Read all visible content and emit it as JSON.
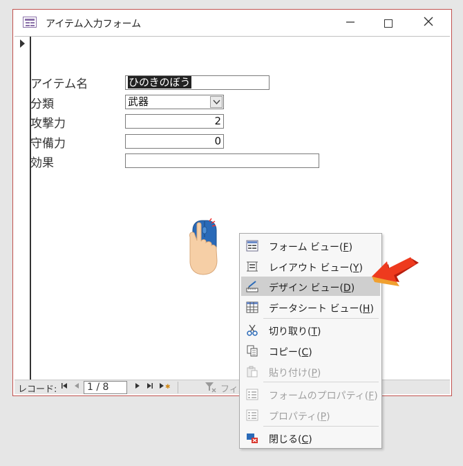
{
  "window": {
    "title": "アイテム入力フォーム"
  },
  "form": {
    "fields": [
      {
        "label": "アイテム名",
        "value": "ひのきのぼう"
      },
      {
        "label": "分類",
        "value": "武器"
      },
      {
        "label": "攻撃力",
        "value": "2"
      },
      {
        "label": "守備力",
        "value": "0"
      },
      {
        "label": "効果",
        "value": ""
      }
    ]
  },
  "nav": {
    "label": "レコード:",
    "position": "1 / 8",
    "filter_label": "フィル"
  },
  "context_menu": {
    "items": [
      {
        "label": "フォーム ビュー(",
        "key": "F",
        "suffix": ")",
        "icon": "form-view-icon",
        "enabled": true
      },
      {
        "label": "レイアウト ビュー(",
        "key": "Y",
        "suffix": ")",
        "icon": "layout-view-icon",
        "enabled": true
      },
      {
        "label": "デザイン ビュー(",
        "key": "D",
        "suffix": ")",
        "icon": "design-view-icon",
        "enabled": true,
        "highlighted": true
      },
      {
        "label": "データシート ビュー(",
        "key": "H",
        "suffix": ")",
        "icon": "datasheet-view-icon",
        "enabled": true
      },
      {
        "label": "切り取り(",
        "key": "T",
        "suffix": ")",
        "icon": "scissors-icon",
        "enabled": true
      },
      {
        "label": "コピー(",
        "key": "C",
        "suffix": ")",
        "icon": "copy-icon",
        "enabled": true
      },
      {
        "label": "貼り付け(",
        "key": "P",
        "suffix": ")",
        "icon": "paste-icon",
        "enabled": false
      },
      {
        "label": "フォームのプロパティ(",
        "key": "F",
        "suffix": ")",
        "icon": "form-properties-icon",
        "enabled": false
      },
      {
        "label": "プロパティ(",
        "key": "P",
        "suffix": ")",
        "icon": "properties-icon",
        "enabled": false
      },
      {
        "label": "閉じる(",
        "key": "C",
        "suffix": ")",
        "icon": "close-form-icon",
        "enabled": true
      }
    ]
  },
  "colors": {
    "window_border": "#c0504d",
    "highlight": "#cfcfcf",
    "arrow": "#e8341c"
  }
}
